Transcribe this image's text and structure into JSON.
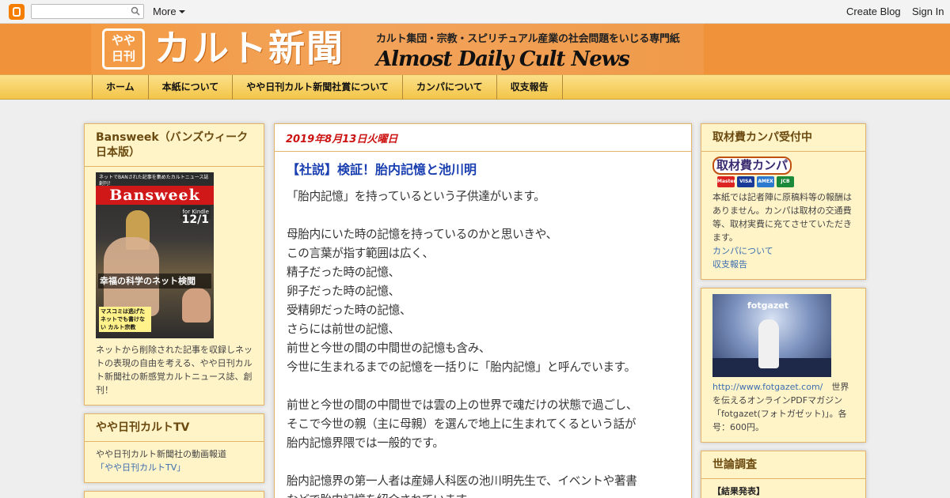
{
  "navbar": {
    "more_label": "More",
    "create_blog": "Create Blog",
    "sign_in": "Sign In"
  },
  "header": {
    "seal_line1": "やや",
    "seal_line2": "日刊",
    "title": "カルト新聞",
    "subtitle": "カルト集団・宗教・スピリチュアル産業の社会問題をいじる専門紙",
    "english_title": "Almost Daily Cult News"
  },
  "tabs": [
    {
      "label": "ホーム"
    },
    {
      "label": "本紙について"
    },
    {
      "label": "やや日刊カルト新聞社賞について"
    },
    {
      "label": "カンパについて"
    },
    {
      "label": "収支報告"
    }
  ],
  "left_sidebar": {
    "bansweek": {
      "title": "Bansweek（バンズウィーク日本版）",
      "cover": {
        "topline": "ネットでBANされた記事を集めたカルトニュース誌創刊！",
        "masthead": "Bansweek",
        "kindle": "for Kindle",
        "date": "12/1",
        "headline": "幸福の科学のネット検閲",
        "bottom": "マスコミは逃げた ネットでも書けない カルト宗教"
      },
      "description": "ネットから削除された記事を収録しネットの表現の自由を考える、やや日刊カルト新聞社の新感覚カルトニュース誌、創刊！"
    },
    "tv": {
      "title": "やや日刊カルトTV",
      "description": "やや日刊カルト新聞社の動画報道",
      "link": "「やや日刊カルトTV」"
    }
  },
  "post": {
    "date": "2019年8月13日火曜日",
    "title": "【社説】検証！胎内記憶と池川明",
    "paragraphs": [
      [
        "「胎内記憶」を持っているという子供達がいます。"
      ],
      [
        "母胎内にいた時の記憶を持っているのかと思いきや、",
        "この言葉が指す範囲は広く、",
        "精子だった時の記憶、",
        "卵子だった時の記憶、",
        "受精卵だった時の記憶、",
        "さらには前世の記憶、",
        "前世と今世の間の中間世の記憶も含み、",
        "今世に生まれるまでの記憶を一括りに「胎内記憶」と呼んでいます。"
      ],
      [
        "前世と今世の間の中間世では雲の上の世界で魂だけの状態で過ごし、",
        "そこで今世の親（主に母親）を選んで地上に生まれてくるという話が",
        "胎内記憶界隈では一般的です。"
      ],
      [
        "胎内記憶界の第一人者は産婦人科医の池川明先生で、イベントや著書",
        "などで胎内記憶を紹介されています。"
      ]
    ]
  },
  "right_sidebar": {
    "kanpa": {
      "title": "取材費カンパ受付中",
      "badge": "取材費カンパ",
      "cards": [
        "Master",
        "VISA",
        "AMEX",
        "JCB"
      ],
      "description": "本紙では記者陣に原稿料等の報酬はありません。カンパは取材の交通費等、取材実費に充てさせていただきます。",
      "link1": "カンパについて",
      "link2": "収支報告"
    },
    "fotgazet": {
      "brand": "fotgazet",
      "link": "http://www.fotgazet.com/",
      "description": "世界を伝えるオンラインPDFマガジン「fotgazet(フォトガゼット)」。各号：600円。"
    },
    "poll": {
      "title": "世論調査",
      "result_label": "【結果発表】"
    }
  }
}
